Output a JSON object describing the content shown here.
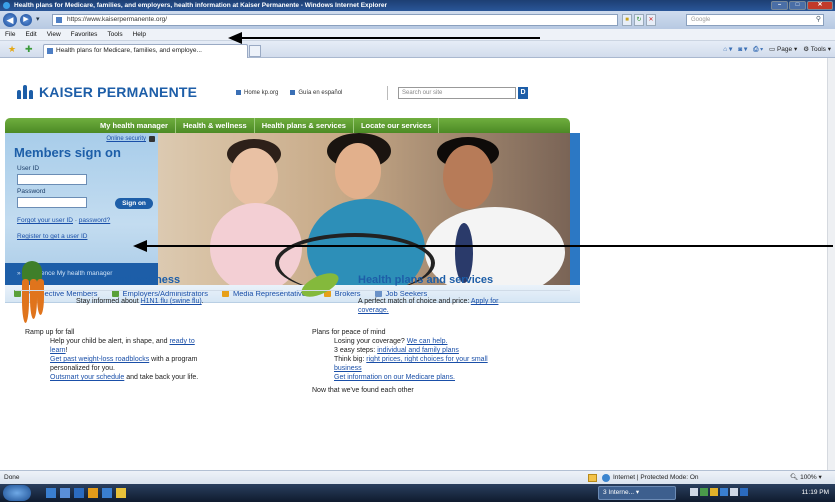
{
  "window": {
    "title": "Health plans for Medicare, families, and employers, health information at Kaiser Permanente - Windows Internet Explorer"
  },
  "address_bar": {
    "url": "https://www.kaiserpermanente.org/",
    "search_placeholder": "Google"
  },
  "menu": [
    "File",
    "Edit",
    "View",
    "Favorites",
    "Tools",
    "Help"
  ],
  "tab": {
    "label": "Health plans for Medicare, families, and employe..."
  },
  "command_bar": {
    "page_label": "Page",
    "tools_label": "Tools"
  },
  "site": {
    "logo": "KAISER PERMANENTE",
    "util_links": [
      "Home kp.org",
      "Guía en español"
    ],
    "search_placeholder": "Search our site",
    "search_button": "D",
    "nav": [
      "My health manager",
      "Health & wellness",
      "Health plans & services",
      "Locate our services"
    ]
  },
  "signin": {
    "online_security": "Online security",
    "title": "Members sign on",
    "user_id_label": "User ID",
    "password_label": "Password",
    "sign_on_button": "Sign on",
    "forgot_user_id": "Forgot your user ID",
    "forgot_password": "password?",
    "register": "Register to get a user ID",
    "experience": "» Experience My health manager"
  },
  "audience": [
    "Prospective Members",
    "Employers/Administrators",
    "Media Representatives",
    "Brokers",
    "Job Seekers"
  ],
  "health_wellness": {
    "title": "Health and wellness",
    "intro_prefix": "Stay informed about ",
    "intro_link": "H1N1 flu (swine flu)",
    "intro_suffix": ".",
    "heading": "Ramp up for fall",
    "line1_prefix": "Help your child be alert, in shape, and ",
    "line1_link": "ready to",
    "line1_link2": "learn",
    "line1_suffix": "!",
    "line2_link": "Get past weight-loss roadblocks",
    "line2_suffix": " with a program",
    "line3": "personalized for you.",
    "line4_link": "Outsmart your schedule",
    "line4_suffix": " and take back your life."
  },
  "health_plans": {
    "title": "Health plans and services",
    "intro": "A perfect match of choice and price: ",
    "intro_link": "Apply for",
    "intro_link2": "coverage.",
    "heading": "Plans for peace of mind",
    "line1_prefix": "Losing your coverage? ",
    "line1_link": "We can help.",
    "line2_prefix": "3 easy steps: ",
    "line2_link": "individual and family plans",
    "line3_prefix": "Think big: ",
    "line3_link": "right prices, right choices for your small",
    "line3_link2": "business",
    "line4_link": "Get information on our Medicare plans.",
    "footer": "Now that we've found each other"
  },
  "status_bar": {
    "left": "Done",
    "zone": "Internet | Protected Mode: On",
    "zoom": "100%"
  },
  "taskbar": {
    "task": "3 Interne...",
    "time": "11:19 PM"
  }
}
